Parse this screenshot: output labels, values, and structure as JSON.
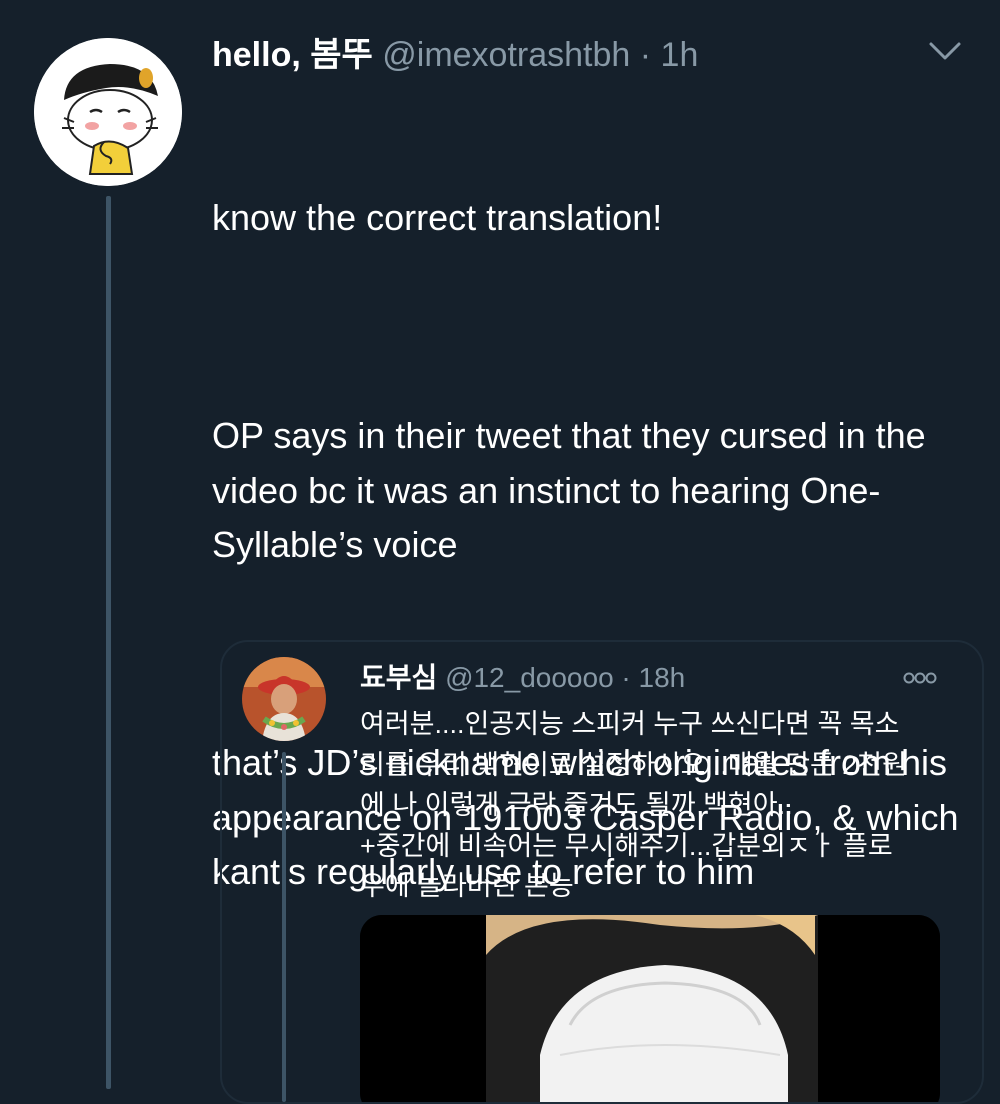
{
  "tweet": {
    "display_name": "hello, 봄뚜",
    "handle": "@imexotrashtbh",
    "separator": " · ",
    "time": "1h",
    "paragraphs": [
      "know the correct translation!",
      "OP says in their tweet that they cursed in the video bc it was an instinct to hearing One-Syllable’s voice",
      "that’s JD’s nickname which originates from his appearance on 191003 Casper Radio, & which kantis regularly use to refer to him"
    ]
  },
  "quote": {
    "display_name": "됴부심",
    "handle": "@12_dooooo",
    "separator": " · ",
    "time": "18h",
    "text": "여러분....인공지능 스피커 누구 쓰신다면 꼭 목소\n리를 우리 백현이로 설정하시오...매월 단돈 2천원\n에 나 이렇게 극락 즐겨도 될까 백현아..\n+중간에 비속어는 무시해주기...갑분외ㅈㅏ 플로\n우에 놀라버린 본능"
  },
  "icons": {
    "menu": "chevron-down-icon",
    "more": "more-dots-icon"
  },
  "colors": {
    "background": "#15202b",
    "text": "#ffffff",
    "secondary": "#8899a6",
    "thread_line": "#3d5466"
  }
}
